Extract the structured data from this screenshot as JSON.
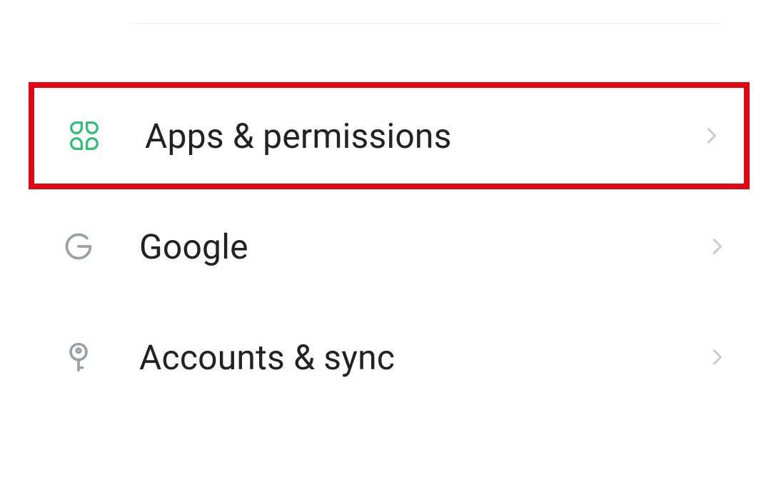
{
  "settings": {
    "items": [
      {
        "label": "Apps & permissions",
        "icon": "apps-icon",
        "highlight": true
      },
      {
        "label": "Google",
        "icon": "google-icon",
        "highlight": false
      },
      {
        "label": "Accounts & sync",
        "icon": "key-icon",
        "highlight": false
      }
    ]
  },
  "colors": {
    "apps_icon": "#2fbf71",
    "gray_icon": "#9aa0a6",
    "chevron": "#c9ccce",
    "highlight": "#e30613"
  }
}
